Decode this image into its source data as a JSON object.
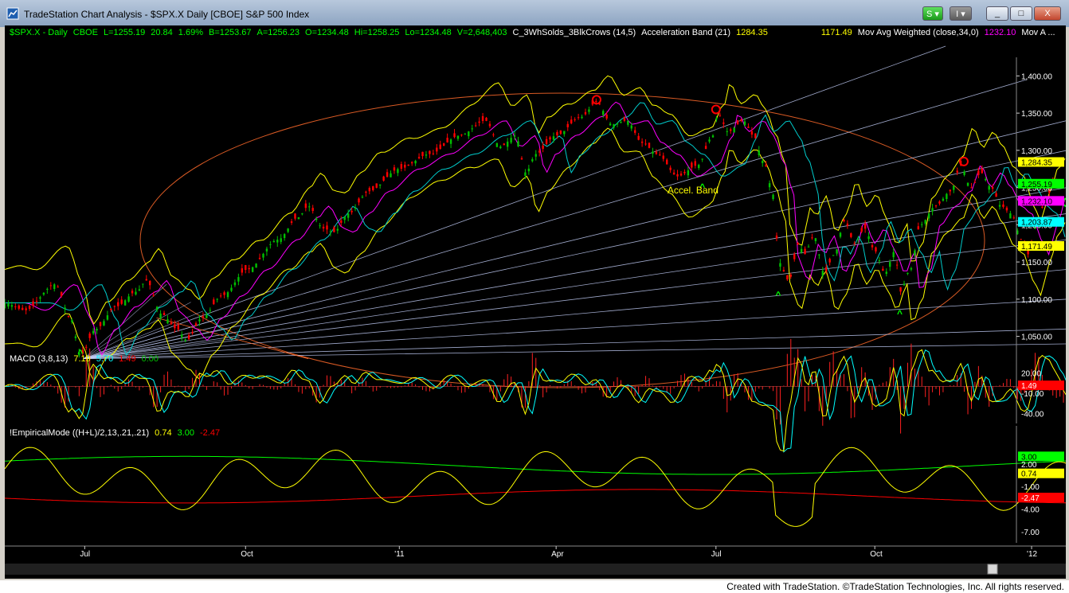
{
  "window": {
    "title": "TradeStation Chart Analysis - $SPX.X Daily [CBOE] S&P 500 Index",
    "s_button": "S",
    "i_button": "I",
    "min_label": "_",
    "max_label": "□",
    "close_label": "X"
  },
  "status_bar": "Created with TradeStation. ©TradeStation Technologies, Inc. All rights reserved.",
  "colors": {
    "background": "#000000",
    "up_candle": "#00c000",
    "down_candle": "#ff0000",
    "accent_yellow": "#ffff00",
    "ellipse": "#ff6a2a",
    "fan": "#c8d4ff"
  },
  "price_panel": {
    "header": [
      {
        "text": "$SPX.X - Daily",
        "color": "#00ff00"
      },
      {
        "text": "CBOE",
        "color": "#00ff00"
      },
      {
        "text": "L=1255.19",
        "color": "#00ff00"
      },
      {
        "text": "20.84",
        "color": "#00ff00"
      },
      {
        "text": "1.69%",
        "color": "#00ff00"
      },
      {
        "text": "B=1253.67",
        "color": "#00ff00"
      },
      {
        "text": "A=1256.23",
        "color": "#00ff00"
      },
      {
        "text": "O=1234.48",
        "color": "#00ff00"
      },
      {
        "text": "Hi=1258.25",
        "color": "#00ff00"
      },
      {
        "text": "Lo=1234.48",
        "color": "#00ff00"
      },
      {
        "text": "V=2,648,403",
        "color": "#00ff00"
      },
      {
        "text": "C_3WhSolds_3BlkCrows (14,5)",
        "color": "#ffffff"
      },
      {
        "text": "Acceleration Band (21)",
        "color": "#ffffff"
      },
      {
        "text": "1284.35",
        "color": "#ffff00"
      },
      {
        "text": "1171.49",
        "color": "#ffff00"
      },
      {
        "text": "Mov Avg Weighted (close,34,0)",
        "color": "#ffffff"
      },
      {
        "text": "1232.10",
        "color": "#ff00ff"
      },
      {
        "text": "Mov A ...",
        "color": "#ffffff"
      }
    ],
    "y_ticks": [
      "1,400.00",
      "1,350.00",
      "1,300.00",
      "1,250.00",
      "1,200.00",
      "1,150.00",
      "1,100.00",
      "1,050.00"
    ],
    "y_tick_values": [
      1400,
      1350,
      1300,
      1250,
      1200,
      1150,
      1100,
      1050
    ],
    "y_range": [
      1010,
      1425
    ],
    "annotation": "Accel. Band",
    "markers": {
      "top": "o",
      "bottom": "^"
    },
    "badges": [
      {
        "text": "1,284.35",
        "value": 1284.35,
        "bg": "#ffff00",
        "fg": "#000000"
      },
      {
        "text": "1,255.19",
        "value": 1255.19,
        "bg": "#00ff00",
        "fg": "#000000"
      },
      {
        "text": "1,232.10",
        "value": 1232.1,
        "bg": "#ff00ff",
        "fg": "#000000"
      },
      {
        "text": "1,203.87",
        "value": 1203.87,
        "bg": "#00ffff",
        "fg": "#000000"
      },
      {
        "text": "1,171.49",
        "value": 1171.49,
        "bg": "#ffff00",
        "fg": "#000000"
      }
    ]
  },
  "macd_panel": {
    "header": [
      {
        "text": "MACD (3,8,13)",
        "color": "#ffffff"
      },
      {
        "text": "7.19",
        "color": "#ffff00"
      },
      {
        "text": "5.70",
        "color": "#00ffff"
      },
      {
        "text": "1.49",
        "color": "#ff0000"
      },
      {
        "text": "0.00",
        "color": "#00c000"
      }
    ],
    "y_ticks": [
      "20.00",
      "-10.00",
      "-40.00"
    ],
    "y_tick_values": [
      20,
      -10,
      -40
    ],
    "y_range": [
      -55,
      30
    ],
    "badge": {
      "text": "1.49",
      "value": 1.49,
      "bg": "#ff0000",
      "fg": "#ffffff"
    }
  },
  "emd_panel": {
    "header": [
      {
        "text": "!EmpiricalMode ((H+L)/2,13,.21,.21)",
        "color": "#ffffff"
      },
      {
        "text": "0.74",
        "color": "#ffff00"
      },
      {
        "text": "3.00",
        "color": "#00ff00"
      },
      {
        "text": "-2.47",
        "color": "#ff0000"
      }
    ],
    "y_ticks": [
      "2.00",
      "-1.00",
      "-4.00",
      "-7.00"
    ],
    "y_tick_values": [
      2,
      -1,
      -4,
      -7
    ],
    "y_range": [
      -8.5,
      6
    ],
    "badges": [
      {
        "text": "3.00",
        "value": 3.0,
        "bg": "#00ff00",
        "fg": "#000000"
      },
      {
        "text": "0.74",
        "value": 0.74,
        "bg": "#ffff00",
        "fg": "#000000"
      },
      {
        "text": "-2.47",
        "value": -2.47,
        "bg": "#ff0000",
        "fg": "#ffffff"
      }
    ]
  },
  "x_axis": {
    "labels": [
      "Jul",
      "Oct",
      "'11",
      "Apr",
      "Jul",
      "Oct",
      "'12"
    ],
    "label_positions": [
      0.079,
      0.238,
      0.39,
      0.545,
      0.703,
      0.86,
      1.015
    ]
  },
  "chart_data": {
    "type": "line",
    "x_labels": [
      "Jul",
      "Oct",
      "'11",
      "Apr",
      "Jul",
      "Oct",
      "'12"
    ],
    "price_knots": [
      [
        0.0,
        1095
      ],
      [
        0.02,
        1085
      ],
      [
        0.05,
        1120
      ],
      [
        0.065,
        1075
      ],
      [
        0.075,
        1025
      ],
      [
        0.09,
        1060
      ],
      [
        0.11,
        1090
      ],
      [
        0.13,
        1110
      ],
      [
        0.14,
        1125
      ],
      [
        0.155,
        1080
      ],
      [
        0.17,
        1060
      ],
      [
        0.18,
        1045
      ],
      [
        0.195,
        1075
      ],
      [
        0.215,
        1105
      ],
      [
        0.24,
        1140
      ],
      [
        0.27,
        1180
      ],
      [
        0.29,
        1210
      ],
      [
        0.3,
        1225
      ],
      [
        0.315,
        1195
      ],
      [
        0.325,
        1190
      ],
      [
        0.34,
        1215
      ],
      [
        0.36,
        1245
      ],
      [
        0.39,
        1275
      ],
      [
        0.42,
        1295
      ],
      [
        0.45,
        1320
      ],
      [
        0.475,
        1340
      ],
      [
        0.49,
        1305
      ],
      [
        0.505,
        1320
      ],
      [
        0.515,
        1270
      ],
      [
        0.525,
        1295
      ],
      [
        0.545,
        1320
      ],
      [
        0.57,
        1345
      ],
      [
        0.585,
        1365
      ],
      [
        0.6,
        1335
      ],
      [
        0.615,
        1340
      ],
      [
        0.63,
        1310
      ],
      [
        0.645,
        1295
      ],
      [
        0.665,
        1265
      ],
      [
        0.685,
        1280
      ],
      [
        0.7,
        1320
      ],
      [
        0.705,
        1350
      ],
      [
        0.715,
        1325
      ],
      [
        0.73,
        1340
      ],
      [
        0.74,
        1320
      ],
      [
        0.75,
        1285
      ],
      [
        0.76,
        1240
      ],
      [
        0.765,
        1150
      ],
      [
        0.775,
        1125
      ],
      [
        0.785,
        1175
      ],
      [
        0.79,
        1160
      ],
      [
        0.8,
        1185
      ],
      [
        0.81,
        1135
      ],
      [
        0.82,
        1160
      ],
      [
        0.83,
        1205
      ],
      [
        0.84,
        1175
      ],
      [
        0.85,
        1195
      ],
      [
        0.86,
        1165
      ],
      [
        0.87,
        1135
      ],
      [
        0.88,
        1165
      ],
      [
        0.885,
        1110
      ],
      [
        0.895,
        1140
      ],
      [
        0.905,
        1200
      ],
      [
        0.92,
        1225
      ],
      [
        0.935,
        1245
      ],
      [
        0.945,
        1280
      ],
      [
        0.955,
        1250
      ],
      [
        0.965,
        1270
      ],
      [
        0.975,
        1250
      ],
      [
        0.985,
        1225
      ],
      [
        0.995,
        1215
      ],
      [
        1.005,
        1180
      ],
      [
        1.012,
        1160
      ],
      [
        1.02,
        1200
      ],
      [
        1.03,
        1240
      ],
      [
        1.04,
        1260
      ],
      [
        1.05,
        1250
      ]
    ],
    "markers_top": [
      [
        0.585,
        1368
      ],
      [
        0.703,
        1355
      ],
      [
        0.948,
        1285
      ],
      [
        1.05,
        1230
      ]
    ],
    "markers_bottom": [
      [
        0.075,
        1032
      ],
      [
        0.69,
        1255
      ],
      [
        0.765,
        1110
      ],
      [
        0.885,
        1085
      ]
    ],
    "series": [
      {
        "name": "Acceleration Band (21)",
        "values": [
          1284.35,
          1171.49
        ]
      },
      {
        "name": "Mov Avg Weighted (close,34,0)",
        "values": [
          1232.1
        ]
      }
    ]
  }
}
